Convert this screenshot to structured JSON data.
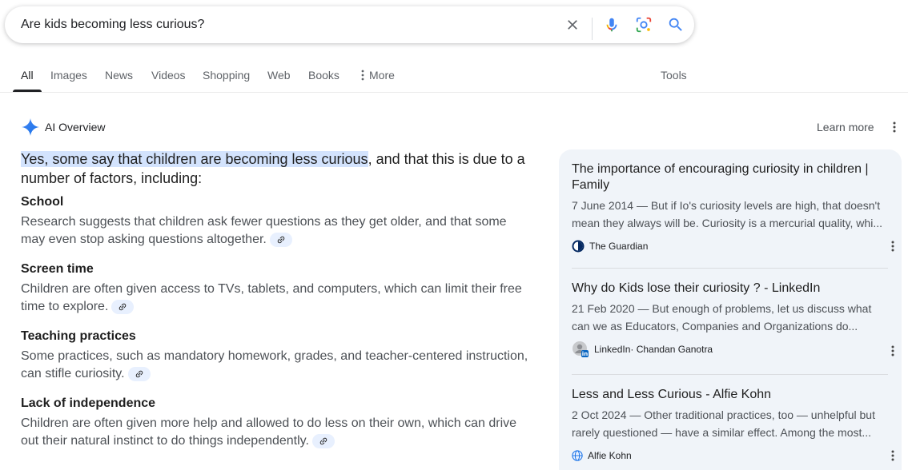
{
  "search": {
    "query": "Are kids becoming less curious?"
  },
  "tabs": [
    {
      "label": "All"
    },
    {
      "label": "Images"
    },
    {
      "label": "News"
    },
    {
      "label": "Videos"
    },
    {
      "label": "Shopping"
    },
    {
      "label": "Web"
    },
    {
      "label": "Books"
    },
    {
      "label": "More"
    },
    {
      "label": "Tools"
    }
  ],
  "ai_overview": {
    "title": "AI Overview",
    "learn_more": "Learn more",
    "lead_highlight": "Yes, some say that children are becoming less curious",
    "lead_rest": ", and that this is due to a number of factors, including:",
    "sections": [
      {
        "title": "School",
        "body": "Research suggests that children ask fewer questions as they get older, and that some may even stop asking questions altogether."
      },
      {
        "title": "Screen time",
        "body": "Children are often given access to TVs, tablets, and computers, which can limit their free time to explore."
      },
      {
        "title": "Teaching practices",
        "body": "Some practices, such as mandatory homework, grades, and teacher-centered instruction, can stifle curiosity."
      },
      {
        "title": "Lack of independence",
        "body": "Children are often given more help and allowed to do less on their own, which can drive out their natural instinct to do things independently."
      }
    ]
  },
  "sources": [
    {
      "title": "The importance of encouraging curiosity in children | Family",
      "snippet": "7 June 2014 — But if Io's curiosity levels are high, that doesn't mean they always will be. Curiosity is a mercurial quality, whi...",
      "site": "The Guardian",
      "author": ""
    },
    {
      "title": "Why do Kids lose their curiosity ? - LinkedIn",
      "snippet": "21 Feb 2020 — But enough of problems, let us discuss what can we as Educators, Companies and Organizations do...",
      "site": "LinkedIn",
      "author": " · Chandan Ganotra"
    },
    {
      "title": "Less and Less Curious - Alfie Kohn",
      "snippet": "2 Oct 2024 — Other traditional practices, too — unhelpful but rarely questioned — have a similar effect. Among the most...",
      "site": "Alfie Kohn",
      "author": ""
    }
  ],
  "colors": {
    "accent": "#4285f4",
    "highlight": "#d3e3fd",
    "panel": "#f0f4f9"
  },
  "icons": [
    "close-icon",
    "mic-icon",
    "lens-icon",
    "search-icon",
    "gemini-sparkle-icon",
    "link-icon",
    "more-vert-icon"
  ]
}
